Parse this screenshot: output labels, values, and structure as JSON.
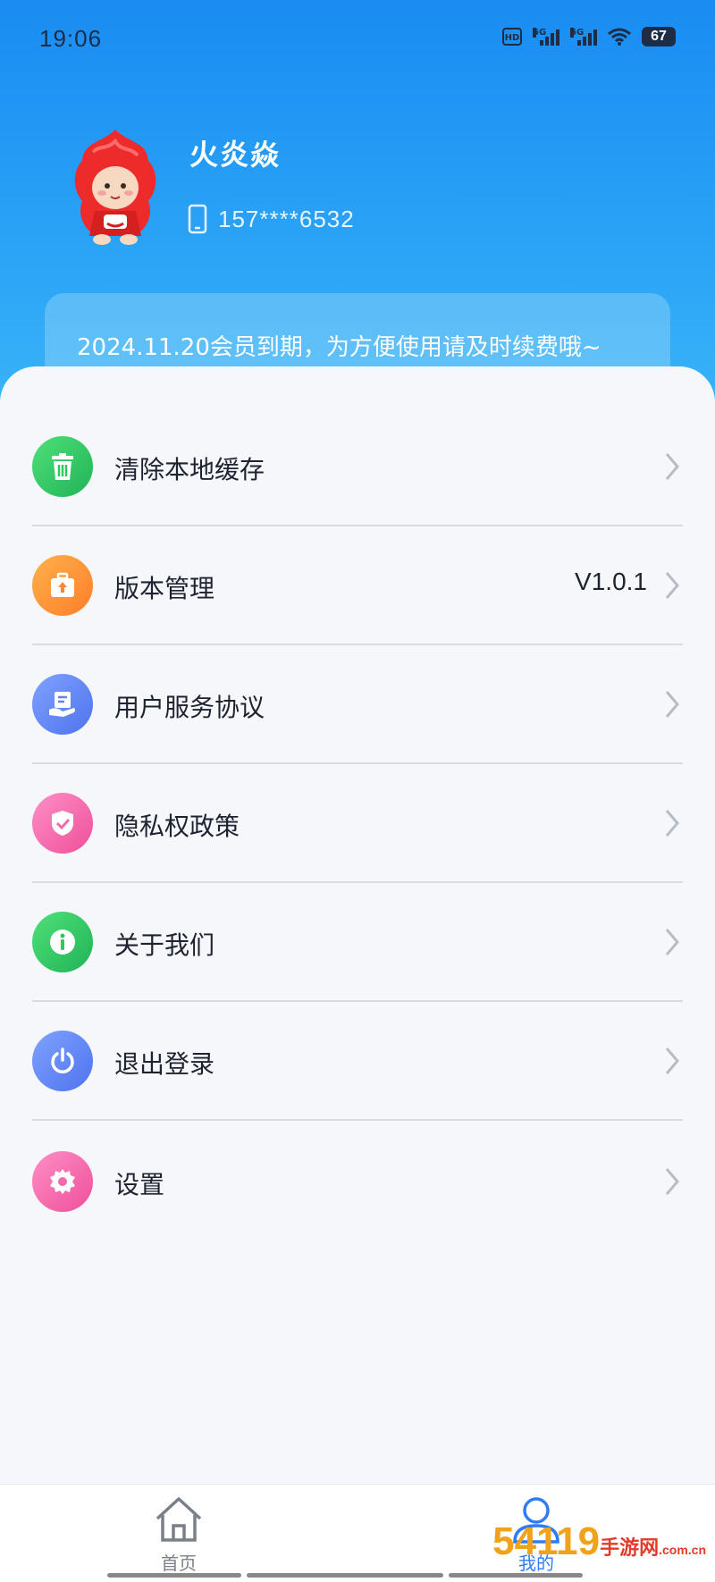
{
  "status_bar": {
    "time": "19:06",
    "battery": "67",
    "network_1": "5G",
    "network_2": "5G",
    "hd": "HD"
  },
  "profile": {
    "name": "火炎焱",
    "phone": "157****6532"
  },
  "notice": {
    "text": "2024.11.20会员到期，为方便使用请及时续费哦~"
  },
  "menu": {
    "items": [
      {
        "label": "清除本地缓存",
        "icon": "trash-icon",
        "color": "#2ec95e"
      },
      {
        "label": "版本管理",
        "value": "V1.0.1",
        "icon": "upload-box-icon",
        "color": "#ff9a3a"
      },
      {
        "label": "用户服务协议",
        "icon": "agreement-icon",
        "color": "#5f83f4"
      },
      {
        "label": "隐私权政策",
        "icon": "shield-check-icon",
        "color": "#f56aac"
      },
      {
        "label": "关于我们",
        "icon": "info-icon",
        "color": "#2ec95e"
      },
      {
        "label": "退出登录",
        "icon": "power-icon",
        "color": "#5f83f4"
      },
      {
        "label": "设置",
        "icon": "gear-icon",
        "color": "#f56aac"
      }
    ]
  },
  "tab_bar": {
    "tabs": [
      {
        "label": "首页",
        "icon": "home-icon",
        "active": false
      },
      {
        "label": "我的",
        "icon": "user-icon",
        "active": true
      }
    ],
    "active_color": "#2f7cf6",
    "inactive_color": "#7b7f88"
  },
  "watermark": {
    "text": "54119",
    "suffix": "手游网",
    "domain": ".com.cn"
  }
}
